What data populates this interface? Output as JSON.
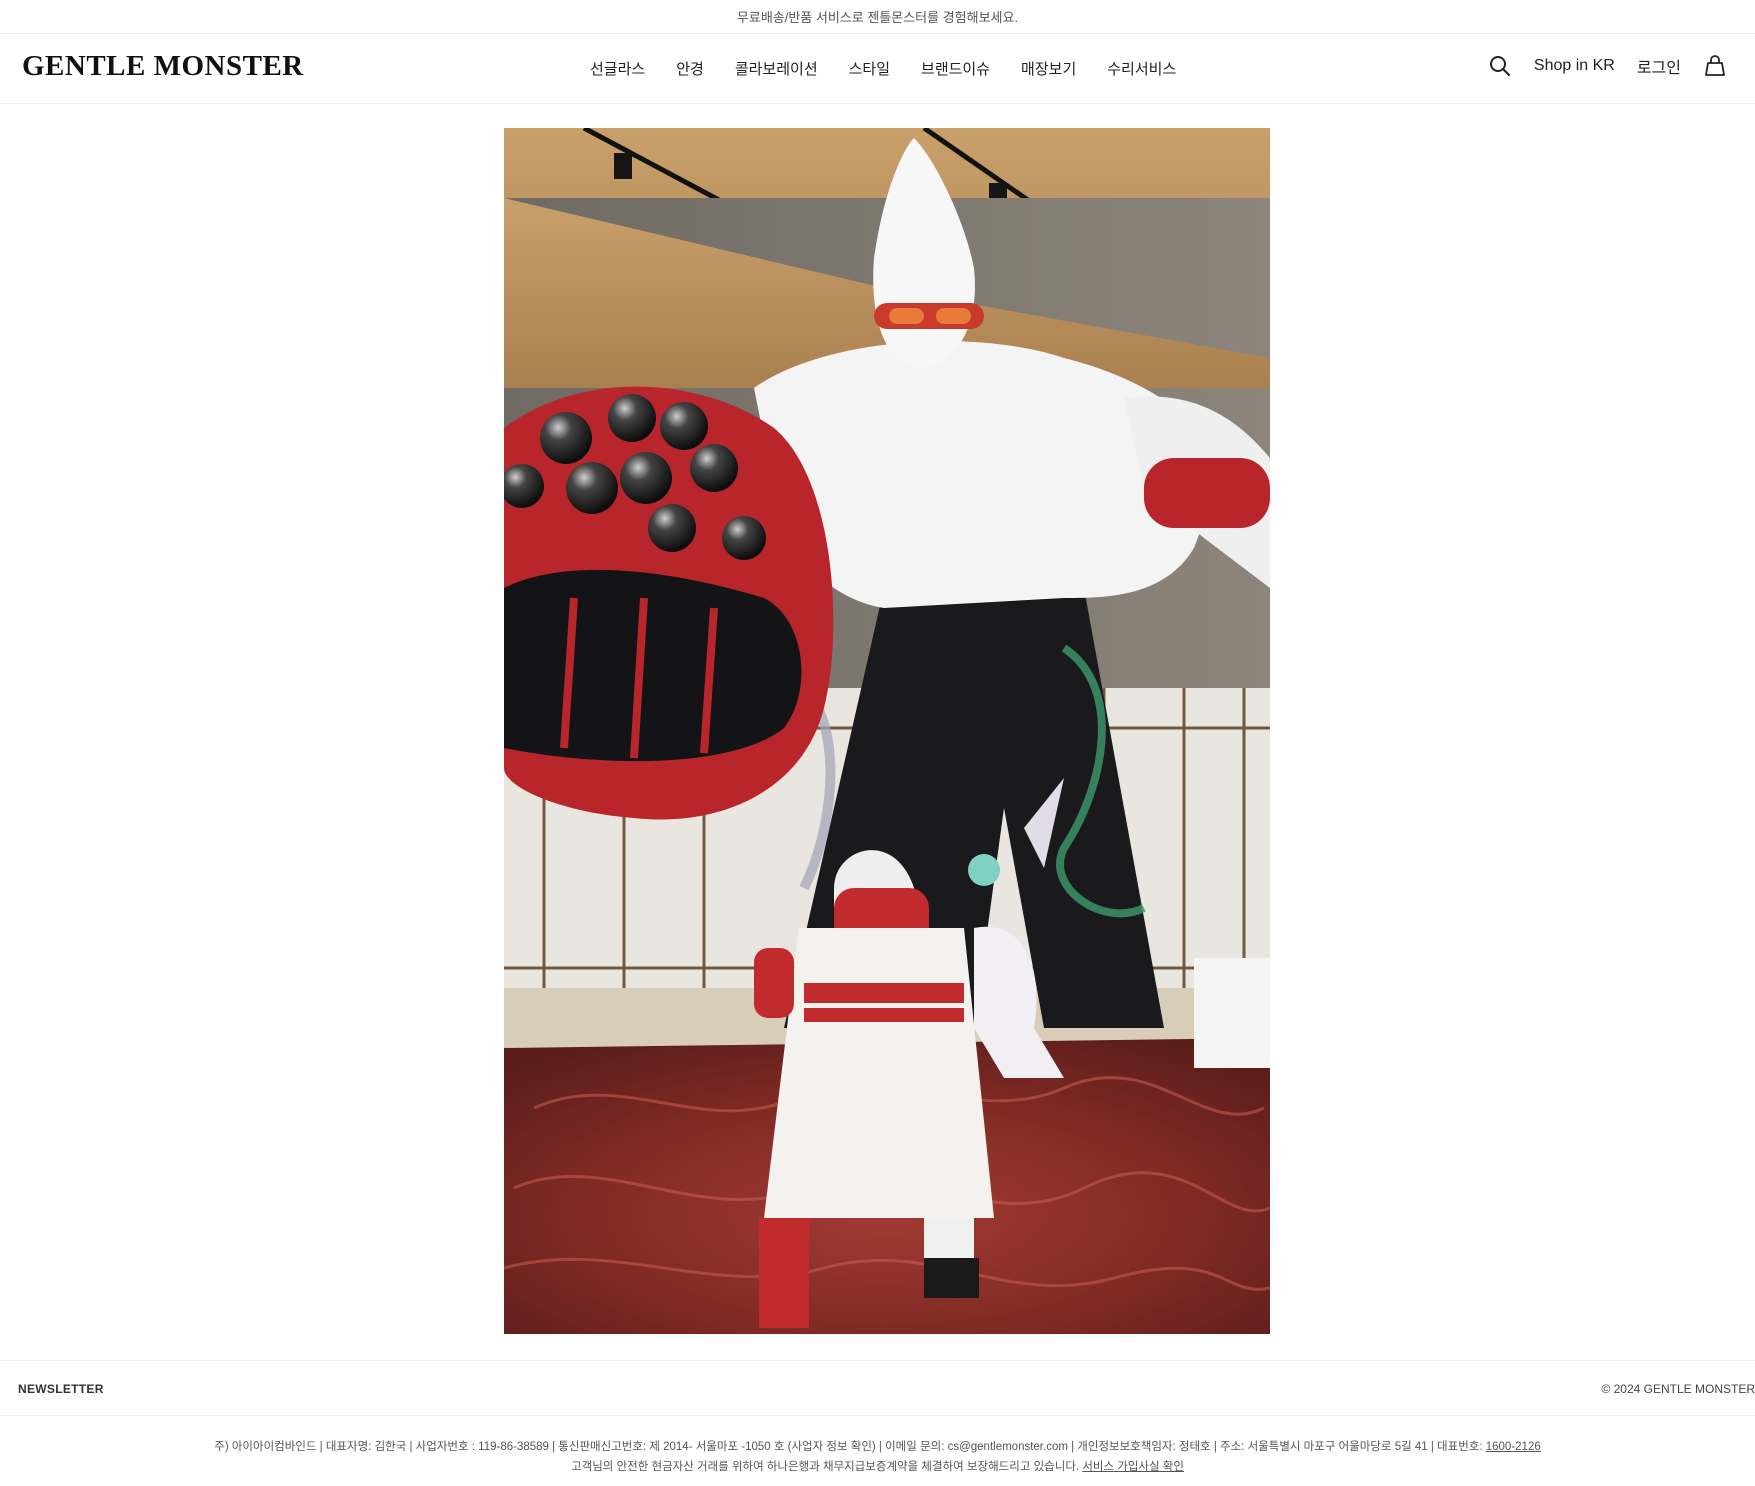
{
  "announcement": "무료배송/반품 서비스로 젠틀몬스터를 경험해보세요.",
  "brand": {
    "logo_text": "GENTLE MONSTER"
  },
  "nav": {
    "items": [
      {
        "label": "선글라스"
      },
      {
        "label": "안경"
      },
      {
        "label": "콜라보레이션"
      },
      {
        "label": "스타일"
      },
      {
        "label": "브랜드이슈"
      },
      {
        "label": "매장보기"
      },
      {
        "label": "수리서비스"
      }
    ]
  },
  "header_right": {
    "search_icon": "search-icon",
    "shop_region": "Shop in KR",
    "login": "로그인",
    "cart_icon": "shopping-bag-icon"
  },
  "footer": {
    "newsletter": "NEWSLETTER",
    "copyright": "© 2024 GENTLE MONSTER",
    "legal_line1": "주) 아이아이컴바인드 | 대표자명: 김한국 | 사업자번호 : 119-86-38589 | 통신판매신고번호: 제 2014- 서울마포 -1050 호 (사업자 정보 확인) | 이메일 문의: cs@gentlemonster.com | 개인정보보호책임자: 정태호 | 주소: 서울특별시 마포구 어울마당로 5길 41 | 대표번호: ",
    "phone": "1600-2126",
    "legal_line2": "고객님의 안전한 현금자산 거래를 위하여 하나은행과 채무지급보증계약을 체결하여 보장해드리고 있습니다. ",
    "service_link": "서비스 가입사실 확인"
  },
  "colors": {
    "hero_red": "#b8262c",
    "hero_wood": "#b8905e",
    "hero_white": "#f2f2f2",
    "hero_black": "#1a1a1d"
  }
}
